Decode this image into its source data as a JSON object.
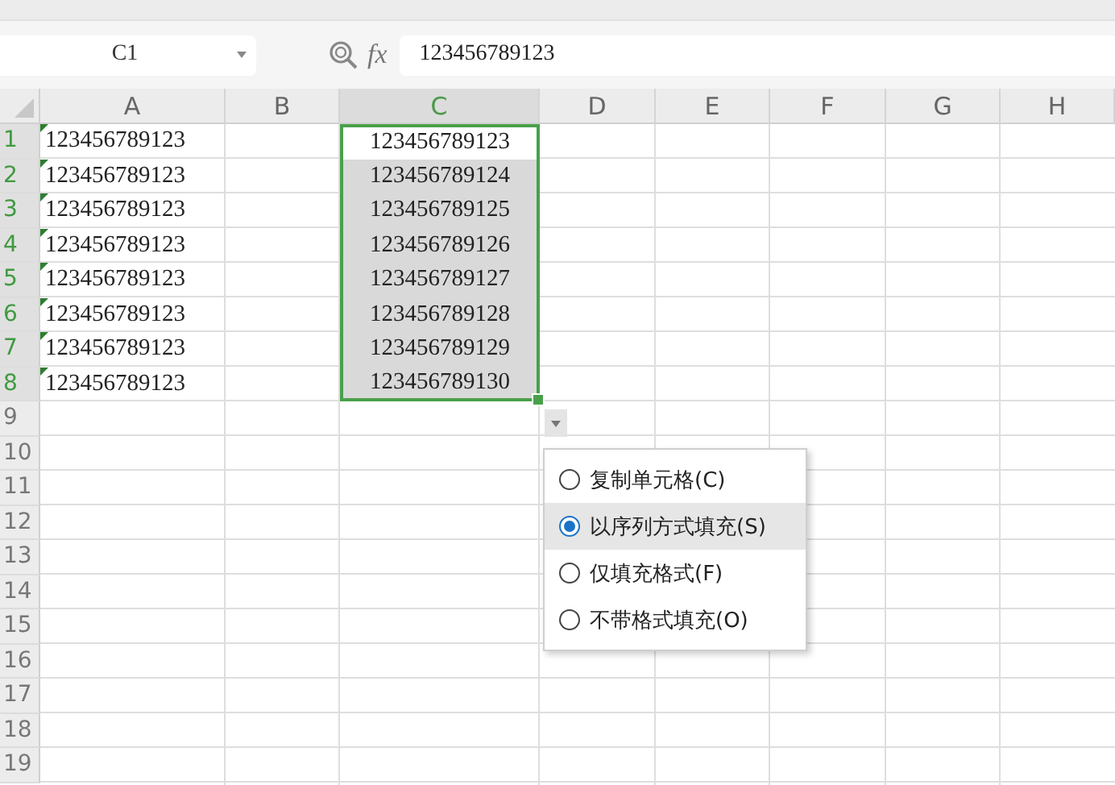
{
  "formula_bar": {
    "name_box": "C1",
    "function_label": "fx",
    "value": "123456789123"
  },
  "columns": [
    {
      "label": "A",
      "selected": false
    },
    {
      "label": "B",
      "selected": false
    },
    {
      "label": "C",
      "selected": true
    },
    {
      "label": "D",
      "selected": false
    },
    {
      "label": "E",
      "selected": false
    },
    {
      "label": "F",
      "selected": false
    },
    {
      "label": "G",
      "selected": false
    },
    {
      "label": "H",
      "selected": false
    }
  ],
  "rows": [
    {
      "header": "1",
      "selected": true,
      "a": {
        "text": "123456789123",
        "flagged": true
      },
      "c": {
        "text": "123456789123",
        "highlighted": false
      }
    },
    {
      "header": "2",
      "selected": true,
      "a": {
        "text": "123456789123",
        "flagged": true
      },
      "c": {
        "text": "123456789124",
        "highlighted": true
      }
    },
    {
      "header": "3",
      "selected": true,
      "a": {
        "text": "123456789123",
        "flagged": true
      },
      "c": {
        "text": "123456789125",
        "highlighted": true
      }
    },
    {
      "header": "4",
      "selected": true,
      "a": {
        "text": "123456789123",
        "flagged": true
      },
      "c": {
        "text": "123456789126",
        "highlighted": true
      }
    },
    {
      "header": "5",
      "selected": true,
      "a": {
        "text": "123456789123",
        "flagged": true
      },
      "c": {
        "text": "123456789127",
        "highlighted": true
      }
    },
    {
      "header": "6",
      "selected": true,
      "a": {
        "text": "123456789123",
        "flagged": true
      },
      "c": {
        "text": "123456789128",
        "highlighted": true
      }
    },
    {
      "header": "7",
      "selected": true,
      "a": {
        "text": "123456789123",
        "flagged": true
      },
      "c": {
        "text": "123456789129",
        "highlighted": true
      }
    },
    {
      "header": "8",
      "selected": true,
      "a": {
        "text": "123456789123",
        "flagged": true
      },
      "c": {
        "text": "123456789130",
        "highlighted": true
      }
    },
    {
      "header": "9",
      "selected": false
    },
    {
      "header": "10",
      "selected": false
    },
    {
      "header": "11",
      "selected": false
    },
    {
      "header": "12",
      "selected": false
    },
    {
      "header": "13",
      "selected": false
    },
    {
      "header": "14",
      "selected": false
    },
    {
      "header": "15",
      "selected": false
    },
    {
      "header": "16",
      "selected": false
    },
    {
      "header": "17",
      "selected": false
    },
    {
      "header": "18",
      "selected": false
    },
    {
      "header": "19",
      "selected": false
    }
  ],
  "fill_options": [
    {
      "label": "复制单元格(C)",
      "selected": false
    },
    {
      "label": "以序列方式填充(S)",
      "selected": true
    },
    {
      "label": "仅填充格式(F)",
      "selected": false
    },
    {
      "label": "不带格式填充(O)",
      "selected": false
    }
  ]
}
